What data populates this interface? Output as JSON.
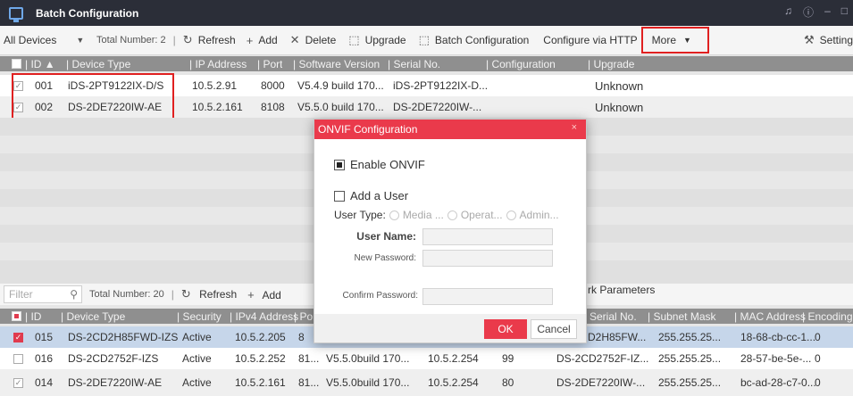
{
  "window": {
    "title": "Batch Configuration",
    "icon": "monitor-icon",
    "controls": [
      "bell-icon",
      "info-icon",
      "minimize-icon",
      "maximize-icon"
    ]
  },
  "toolbar": {
    "device_filter": "All Devices",
    "total": "Total Number: 2",
    "refresh": "Refresh",
    "add": "Add",
    "delete": "Delete",
    "upgrade": "Upgrade",
    "batch_config": "Batch Configuration",
    "configure_http": "Configure via HTTP",
    "more": "More",
    "settings": "Setting"
  },
  "top_table": {
    "headers": [
      "ID",
      "Device Type",
      "IP Address",
      "Port",
      "Software Version",
      "Serial No.",
      "Configuration",
      "Upgrade"
    ],
    "rows": [
      {
        "id": "001",
        "type": "iDS-2PT9122IX-D/S",
        "ip": "10.5.2.91",
        "port": "8000",
        "version": "V5.4.9 build 170...",
        "serial": "iDS-2PT9122IX-D...",
        "config": "",
        "upgrade": "Unknown"
      },
      {
        "id": "002",
        "type": "DS-2DE7220IW-AE",
        "ip": "10.5.2.161",
        "port": "8108",
        "version": "V5.5.0 build 170...",
        "serial": "DS-2DE7220IW-...",
        "config": "",
        "upgrade": "Unknown"
      }
    ]
  },
  "bottom_toolbar": {
    "filter_placeholder": "Filter",
    "total": "Total Number: 20",
    "refresh": "Refresh",
    "add": "Add",
    "network_params": "rk Parameters"
  },
  "bottom_table": {
    "headers": [
      "ID",
      "Device Type",
      "Security",
      "IPv4 Address",
      "Po",
      "Serial No.",
      "Subnet Mask",
      "MAC Address",
      "Encoding"
    ],
    "rows": [
      {
        "id": "015",
        "type": "DS-2CD2H85FWD-IZS",
        "security": "Active",
        "ip": "10.5.2.205",
        "port": "8",
        "version": "",
        "gateway": "",
        "http": "",
        "serial": "D2H85FW...",
        "mask": "255.255.25...",
        "mac": "18-68-cb-cc-1...",
        "enc": "0"
      },
      {
        "id": "016",
        "type": "DS-2CD2752F-IZS",
        "security": "Active",
        "ip": "10.5.2.252",
        "port": "81...",
        "version": "V5.5.0build 170...",
        "gateway": "10.5.2.254",
        "http": "99",
        "serial": "DS-2CD2752F-IZ...",
        "mask": "255.255.25...",
        "mac": "28-57-be-5e-...",
        "enc": "0"
      },
      {
        "id": "014",
        "type": "DS-2DE7220IW-AE",
        "security": "Active",
        "ip": "10.5.2.161",
        "port": "81...",
        "version": "V5.5.0build 170...",
        "gateway": "10.5.2.254",
        "http": "80",
        "serial": "DS-2DE7220IW-...",
        "mask": "255.255.25...",
        "mac": "bc-ad-28-c7-0...",
        "enc": "0"
      }
    ]
  },
  "dialog": {
    "title": "ONVIF Configuration",
    "enable_onvif": "Enable ONVIF",
    "add_user": "Add a User",
    "user_type_label": "User Type:",
    "user_types": [
      "Media ...",
      "Operat...",
      "Admin..."
    ],
    "user_name_label": "User Name:",
    "new_password_label": "New Password:",
    "confirm_password_label": "Confirm Password:",
    "ok": "OK",
    "cancel": "Cancel"
  }
}
